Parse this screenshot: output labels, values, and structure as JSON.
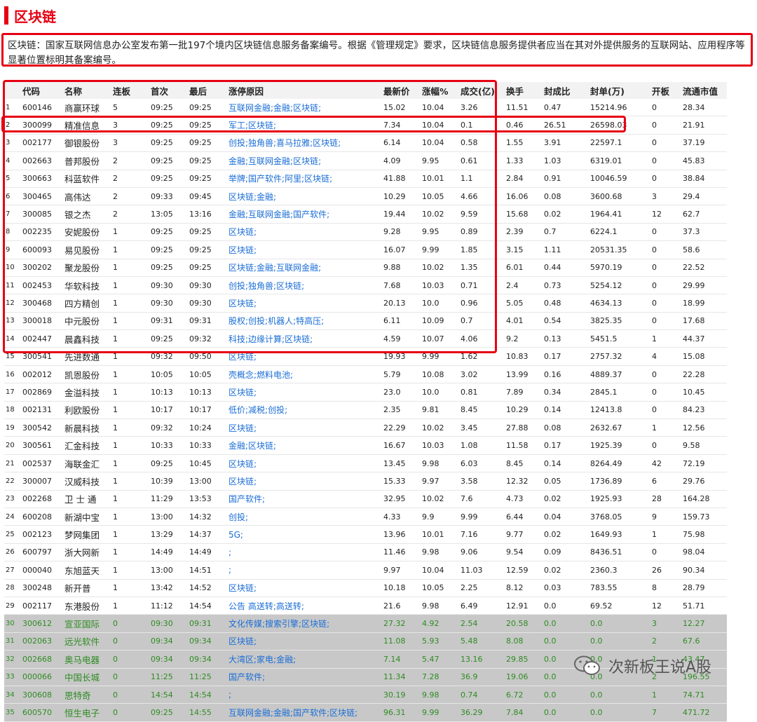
{
  "page": {
    "title": "区块链",
    "description": "区块链：国家互联网信息办公室发布第一批197个境内区块链信息服务备案编号。根据《管理规定》要求，区块链信息服务提供者应当在其对外提供服务的互联网站、应用程序等显著位置标明其备案编号。",
    "watermark": "次新板王说A股"
  },
  "colors": {
    "accent": "#e60012",
    "reason_link": "#1a6dd6",
    "gray_row_bg": "#c8c8c8",
    "gray_row_text": "#2e8b22"
  },
  "table": {
    "headers": [
      "代码",
      "名称",
      "连板",
      "首次",
      "最后",
      "涨停原因",
      "最新价",
      "涨幅%",
      "成交(亿)",
      "换手",
      "封成比",
      "封单(万)",
      "开板",
      "流通市值"
    ],
    "rows": [
      [
        "1",
        "600146",
        "商赢环球",
        "5",
        "09:25",
        "09:25",
        "互联网金融;金融;区块链;",
        "15.02",
        "10.04",
        "3.26",
        "11.51",
        "0.47",
        "15214.96",
        "0",
        "28.34"
      ],
      [
        "2",
        "300099",
        "精准信息",
        "3",
        "09:25",
        "09:25",
        "军工;区块链;",
        "7.34",
        "10.04",
        "0.1",
        "0.46",
        "26.51",
        "26598.03",
        "0",
        "21.91"
      ],
      [
        "3",
        "002177",
        "御银股份",
        "3",
        "09:25",
        "09:25",
        "创投;独角兽;喜马拉雅;区块链;",
        "6.14",
        "10.04",
        "0.58",
        "1.55",
        "3.91",
        "22597.1",
        "0",
        "37.19"
      ],
      [
        "4",
        "002663",
        "普邦股份",
        "2",
        "09:25",
        "09:25",
        "金融;互联网金融;区块链;",
        "4.09",
        "9.95",
        "0.61",
        "1.33",
        "1.03",
        "6319.01",
        "0",
        "45.83"
      ],
      [
        "5",
        "300663",
        "科蓝软件",
        "2",
        "09:25",
        "09:25",
        "举牌;国产软件;阿里;区块链;",
        "41.88",
        "10.01",
        "1.1",
        "2.84",
        "0.91",
        "10046.59",
        "0",
        "38.84"
      ],
      [
        "6",
        "300465",
        "高伟达",
        "2",
        "09:33",
        "09:45",
        "区块链;金融;",
        "10.29",
        "10.05",
        "4.66",
        "16.06",
        "0.08",
        "3600.68",
        "3",
        "29.4"
      ],
      [
        "7",
        "300085",
        "银之杰",
        "2",
        "13:05",
        "13:16",
        "金融;互联网金融;国产软件;",
        "19.44",
        "10.02",
        "9.59",
        "15.68",
        "0.02",
        "1964.41",
        "12",
        "62.7"
      ],
      [
        "8",
        "002235",
        "安妮股份",
        "1",
        "09:25",
        "09:25",
        "区块链;",
        "9.28",
        "9.95",
        "0.89",
        "2.39",
        "0.7",
        "6224.1",
        "0",
        "37.3"
      ],
      [
        "9",
        "600093",
        "易见股份",
        "1",
        "09:25",
        "09:25",
        "区块链;",
        "16.07",
        "9.99",
        "1.85",
        "3.15",
        "1.11",
        "20531.35",
        "0",
        "58.6"
      ],
      [
        "10",
        "300202",
        "聚龙股份",
        "1",
        "09:25",
        "09:25",
        "区块链;金融;互联网金融;",
        "9.88",
        "10.02",
        "1.35",
        "6.01",
        "0.44",
        "5970.19",
        "0",
        "22.52"
      ],
      [
        "11",
        "002453",
        "华软科技",
        "1",
        "09:30",
        "09:30",
        "创投;独角兽;区块链;",
        "7.68",
        "10.03",
        "0.71",
        "2.4",
        "0.73",
        "5254.12",
        "0",
        "29.99"
      ],
      [
        "12",
        "300468",
        "四方精创",
        "1",
        "09:30",
        "09:30",
        "区块链;",
        "20.13",
        "10.0",
        "0.96",
        "5.05",
        "0.48",
        "4634.13",
        "0",
        "18.99"
      ],
      [
        "13",
        "300018",
        "中元股份",
        "1",
        "09:31",
        "09:31",
        "股权;创投;机器人;特高压;",
        "6.11",
        "10.09",
        "0.7",
        "4.01",
        "0.54",
        "3825.35",
        "0",
        "17.68"
      ],
      [
        "14",
        "002447",
        "晨鑫科技",
        "1",
        "09:25",
        "09:32",
        "科技;边缘计算;区块链;",
        "4.59",
        "10.07",
        "4.06",
        "9.2",
        "0.13",
        "5451.5",
        "1",
        "44.37"
      ],
      [
        "15",
        "300541",
        "先进数通",
        "1",
        "09:32",
        "09:50",
        "区块链;",
        "19.93",
        "9.99",
        "1.62",
        "10.83",
        "0.17",
        "2757.32",
        "4",
        "15.08"
      ],
      [
        "16",
        "002012",
        "凯恩股份",
        "1",
        "10:05",
        "10:05",
        "壳概念;燃料电池;",
        "5.79",
        "10.08",
        "3.02",
        "13.99",
        "0.16",
        "4889.37",
        "0",
        "22.28"
      ],
      [
        "17",
        "002869",
        "金溢科技",
        "1",
        "10:13",
        "10:13",
        "区块链;",
        "23.0",
        "10.0",
        "0.81",
        "7.89",
        "0.34",
        "2845.1",
        "0",
        "10.45"
      ],
      [
        "18",
        "002131",
        "利欧股份",
        "1",
        "10:17",
        "10:17",
        "低价;减税;创投;",
        "2.35",
        "9.81",
        "8.45",
        "10.29",
        "0.14",
        "12413.8",
        "0",
        "84.23"
      ],
      [
        "19",
        "300542",
        "新晨科技",
        "1",
        "09:32",
        "10:24",
        "区块链;",
        "22.29",
        "10.02",
        "3.45",
        "27.88",
        "0.08",
        "2632.67",
        "1",
        "12.56"
      ],
      [
        "20",
        "300561",
        "汇金科技",
        "1",
        "10:33",
        "10:33",
        "金融;区块链;",
        "16.67",
        "10.03",
        "1.08",
        "11.58",
        "0.17",
        "1925.39",
        "0",
        "9.58"
      ],
      [
        "21",
        "002537",
        "海联金汇",
        "1",
        "09:25",
        "10:45",
        "区块链;",
        "13.45",
        "9.98",
        "6.03",
        "8.45",
        "0.14",
        "8264.49",
        "42",
        "72.19"
      ],
      [
        "22",
        "300007",
        "汉威科技",
        "1",
        "10:39",
        "13:00",
        "区块链;",
        "15.33",
        "9.97",
        "3.58",
        "12.32",
        "0.05",
        "1736.89",
        "6",
        "29.76"
      ],
      [
        "23",
        "002268",
        "卫 士 通",
        "1",
        "11:29",
        "13:53",
        "国产软件;",
        "32.95",
        "10.02",
        "7.6",
        "4.73",
        "0.02",
        "1925.93",
        "28",
        "164.28"
      ],
      [
        "24",
        "600208",
        "新湖中宝",
        "1",
        "13:00",
        "14:32",
        "创投;",
        "4.33",
        "9.9",
        "9.99",
        "6.44",
        "0.04",
        "3768.05",
        "9",
        "159.73"
      ],
      [
        "25",
        "002123",
        "梦网集团",
        "1",
        "13:29",
        "14:37",
        "5G;",
        "13.96",
        "10.01",
        "7.16",
        "9.77",
        "0.02",
        "1649.93",
        "1",
        "75.98"
      ],
      [
        "26",
        "600797",
        "浙大网新",
        "1",
        "14:49",
        "14:49",
        ";",
        "11.46",
        "9.98",
        "9.06",
        "9.54",
        "0.09",
        "8436.51",
        "0",
        "98.04"
      ],
      [
        "27",
        "000040",
        "东旭蓝天",
        "1",
        "13:00",
        "14:51",
        ";",
        "9.97",
        "10.04",
        "11.03",
        "12.59",
        "0.02",
        "2360.3",
        "26",
        "90.34"
      ],
      [
        "28",
        "300248",
        "新开普",
        "1",
        "13:42",
        "14:52",
        "区块链;",
        "10.18",
        "10.05",
        "2.25",
        "8.12",
        "0.03",
        "783.55",
        "8",
        "28.79"
      ],
      [
        "29",
        "002117",
        "东港股份",
        "1",
        "11:12",
        "14:54",
        "公告 高送转;高送转;",
        "21.6",
        "9.98",
        "6.49",
        "12.91",
        "0.0",
        "69.52",
        "12",
        "51.71"
      ],
      [
        "30",
        "300612",
        "宣亚国际",
        "0",
        "09:30",
        "09:31",
        "文化传媒;搜索引擎;区块链;",
        "27.32",
        "4.92",
        "2.54",
        "20.58",
        "0.0",
        "0.0",
        "3",
        "12.27"
      ],
      [
        "31",
        "002063",
        "远光软件",
        "0",
        "09:34",
        "09:34",
        "区块链;",
        "11.08",
        "5.93",
        "5.48",
        "8.08",
        "0.0",
        "0.0",
        "2",
        "67.6"
      ],
      [
        "32",
        "002668",
        "奥马电器",
        "0",
        "09:34",
        "09:34",
        "大湾区;家电;金融;",
        "7.14",
        "5.47",
        "13.16",
        "29.85",
        "0.0",
        "0.0",
        "1",
        "43.47"
      ],
      [
        "33",
        "000066",
        "中国长城",
        "0",
        "11:25",
        "11:25",
        "国产软件;",
        "11.34",
        "7.28",
        "36.9",
        "19.06",
        "0.0",
        "0.0",
        "2",
        "196.55"
      ],
      [
        "34",
        "300608",
        "思特奇",
        "0",
        "14:54",
        "14:54",
        ";",
        "30.19",
        "9.98",
        "0.74",
        "6.72",
        "0.0",
        "0.0",
        "1",
        "74.71"
      ],
      [
        "35",
        "600570",
        "恒生电子",
        "0",
        "09:25",
        "14:55",
        "互联网金融;金融;国产软件;区块链;",
        "96.31",
        "9.99",
        "36.29",
        "7.84",
        "0.0",
        "0.0",
        "7",
        "471.72"
      ]
    ]
  }
}
